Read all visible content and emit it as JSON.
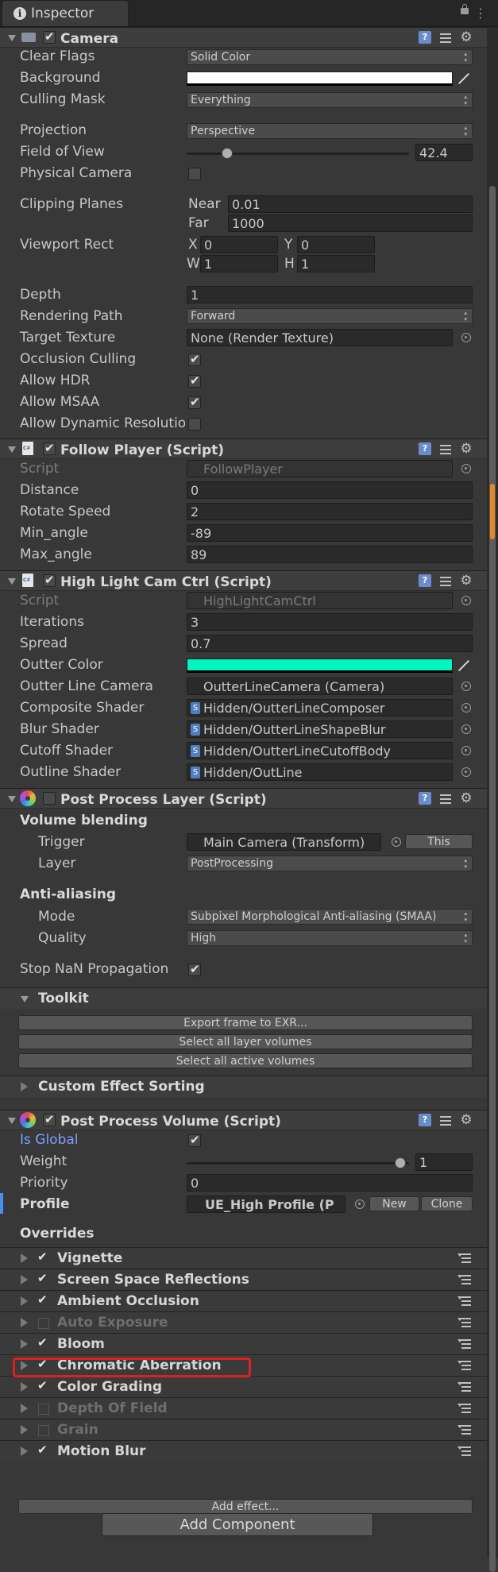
{
  "tab": {
    "title": "Inspector",
    "info_glyph": "i",
    "menu_glyph": "⋮"
  },
  "camera": {
    "title": "Camera",
    "clear_flags": {
      "label": "Clear Flags",
      "value": "Solid Color"
    },
    "background": {
      "label": "Background",
      "color": "#ffffff"
    },
    "culling_mask": {
      "label": "Culling Mask",
      "value": "Everything"
    },
    "projection": {
      "label": "Projection",
      "value": "Perspective"
    },
    "fov": {
      "label": "Field of View",
      "value": "42.4",
      "fraction": 0.18
    },
    "physical_camera": {
      "label": "Physical Camera",
      "checked": false
    },
    "clipping": {
      "label": "Clipping Planes",
      "near_label": "Near",
      "near": "0.01",
      "far_label": "Far",
      "far": "1000"
    },
    "viewport": {
      "label": "Viewport Rect",
      "x_label": "X",
      "x": "0",
      "y_label": "Y",
      "y": "0",
      "w_label": "W",
      "w": "1",
      "h_label": "H",
      "h": "1"
    },
    "depth": {
      "label": "Depth",
      "value": "1"
    },
    "rendering_path": {
      "label": "Rendering Path",
      "value": "Forward"
    },
    "target_texture": {
      "label": "Target Texture",
      "value": "None (Render Texture)"
    },
    "occlusion": {
      "label": "Occlusion Culling",
      "checked": true
    },
    "hdr": {
      "label": "Allow HDR",
      "checked": true
    },
    "msaa": {
      "label": "Allow MSAA",
      "checked": true
    },
    "dynamic": {
      "label": "Allow Dynamic Resolutio",
      "checked": false
    }
  },
  "follow": {
    "title": "Follow Player (Script)",
    "script_label": "Script",
    "script": "FollowPlayer",
    "distance": {
      "label": "Distance",
      "value": "0"
    },
    "rotate": {
      "label": "Rotate Speed",
      "value": "2"
    },
    "min": {
      "label": "Min_angle",
      "value": "-89"
    },
    "max": {
      "label": "Max_angle",
      "value": "89"
    }
  },
  "hl": {
    "title": "High Light Cam Ctrl (Script)",
    "script_label": "Script",
    "script": "HighLightCamCtrl",
    "iterations": {
      "label": "Iterations",
      "value": "3"
    },
    "spread": {
      "label": "Spread",
      "value": "0.7"
    },
    "outter_color": {
      "label": "Outter Color",
      "color": "#00f5c0"
    },
    "line_camera": {
      "label": "Outter Line Camera",
      "value": "OutterLineCamera (Camera)"
    },
    "composite": {
      "label": "Composite Shader",
      "value": "Hidden/OutterLineComposer"
    },
    "blur": {
      "label": "Blur Shader",
      "value": "Hidden/OutterLineShapeBlur"
    },
    "cutoff": {
      "label": "Cutoff Shader",
      "value": "Hidden/OutterLineCutoffBody"
    },
    "outline": {
      "label": "Outline Shader",
      "value": "Hidden/OutLine"
    },
    "shader_glyph": "S"
  },
  "ppl": {
    "title": "Post Process Layer (Script)",
    "volume_blending": "Volume blending",
    "trigger": {
      "label": "Trigger",
      "value": "Main Camera (Transform)",
      "button": "This"
    },
    "layer": {
      "label": "Layer",
      "value": "PostProcessing"
    },
    "anti_aliasing": "Anti-aliasing",
    "mode": {
      "label": "Mode",
      "value": "Subpixel Morphological Anti-aliasing (SMAA)"
    },
    "quality": {
      "label": "Quality",
      "value": "High"
    },
    "stop_nan": {
      "label": "Stop NaN Propagation",
      "checked": true
    },
    "toolkit": "Toolkit",
    "export_btn": "Export frame to EXR...",
    "select_layer_btn": "Select all layer volumes",
    "select_active_btn": "Select all active volumes",
    "custom_sorting": "Custom Effect Sorting"
  },
  "ppv": {
    "title": "Post Process Volume (Script)",
    "is_global": {
      "label": "Is Global",
      "checked": true
    },
    "weight": {
      "label": "Weight",
      "value": "1",
      "fraction": 1.0
    },
    "priority": {
      "label": "Priority",
      "value": "0"
    },
    "profile": {
      "label": "Profile",
      "value": "UE_High Profile (P",
      "new_btn": "New",
      "clone_btn": "Clone"
    },
    "overrides": "Overrides",
    "items": [
      {
        "label": "Vignette",
        "enabled": true
      },
      {
        "label": "Screen Space Reflections",
        "enabled": true
      },
      {
        "label": "Ambient Occlusion",
        "enabled": true
      },
      {
        "label": "Auto Exposure",
        "enabled": false
      },
      {
        "label": "Bloom",
        "enabled": true
      },
      {
        "label": "Chromatic Aberration",
        "enabled": true
      },
      {
        "label": "Color Grading",
        "enabled": true
      },
      {
        "label": "Depth Of Field",
        "enabled": false
      },
      {
        "label": "Grain",
        "enabled": false
      },
      {
        "label": "Motion Blur",
        "enabled": true
      }
    ],
    "add_effect": "Add effect..."
  },
  "add_component": "Add Component",
  "colors": {
    "accent": "#e02020",
    "profile_accent": "#4a8cf0",
    "scroll_accent": "#e28a2a"
  }
}
